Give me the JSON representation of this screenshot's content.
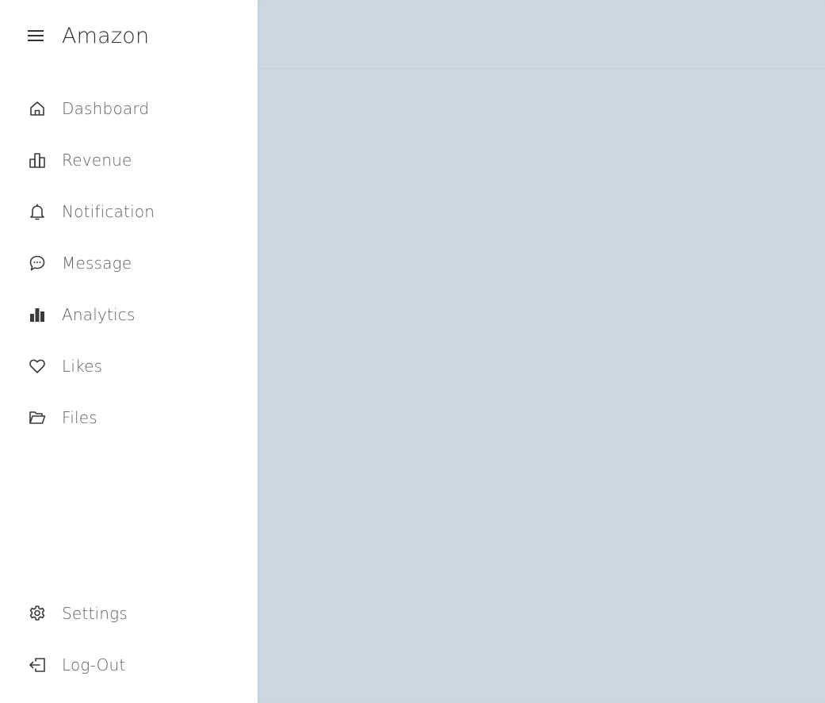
{
  "brand": {
    "title": "Amazon",
    "menu_icon": "hamburger-menu-icon"
  },
  "nav": {
    "items": [
      {
        "label": "Dashboard",
        "icon": "home-icon"
      },
      {
        "label": "Revenue",
        "icon": "bar-chart-outline-icon"
      },
      {
        "label": "Notification",
        "icon": "bell-icon"
      },
      {
        "label": "Message",
        "icon": "chat-bubble-icon"
      },
      {
        "label": "Analytics",
        "icon": "bar-chart-filled-icon"
      },
      {
        "label": "Likes",
        "icon": "heart-icon"
      },
      {
        "label": "Files",
        "icon": "folder-open-icon"
      }
    ],
    "bottom_items": [
      {
        "label": "Settings",
        "icon": "gear-icon"
      },
      {
        "label": "Log-Out",
        "icon": "logout-icon"
      }
    ]
  },
  "colors": {
    "sidebar_bg": "#ffffff",
    "main_bg": "#cbd8e1",
    "text": "#5f5f5f",
    "icon": "#3a3a3a"
  }
}
